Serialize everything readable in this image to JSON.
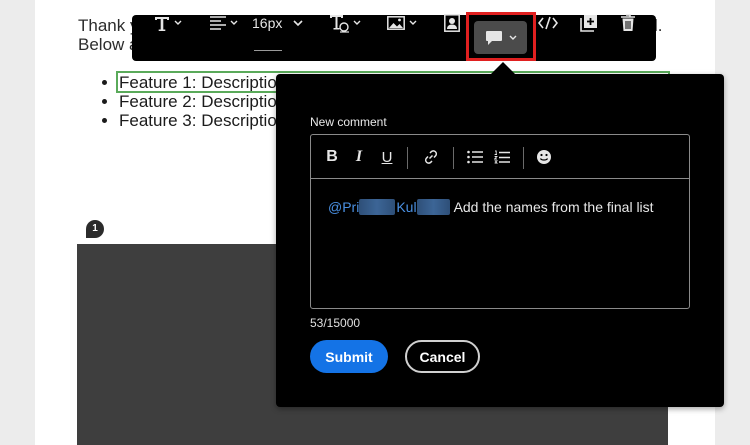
{
  "document": {
    "line1": "Thank y",
    "line2": "Below a",
    "line1_end": "l.",
    "features": [
      "Feature 1: Descriptio",
      "Feature 2: Descriptio",
      "Feature 3: Descriptio"
    ],
    "marker_number": "1"
  },
  "toolbar": {
    "font_size": "16px",
    "icons": [
      "text-style-icon",
      "align-icon",
      "font-size-dropdown",
      "text-color-icon",
      "image-icon",
      "portrait-icon",
      "comment-icon",
      "code-icon",
      "duplicate-icon",
      "trash-icon"
    ]
  },
  "comment": {
    "title": "New comment",
    "mention_prefix_1": "@Pri",
    "mention_prefix_2": "Kul",
    "text": "Add the names from the final list",
    "counter": "53/15000",
    "submit_label": "Submit",
    "cancel_label": "Cancel",
    "format": {
      "bold": "B",
      "italic": "I",
      "underline": "U"
    }
  },
  "colors": {
    "toolbar_bg": "#000000",
    "highlight": "#e02020",
    "accent": "#1473e6",
    "mention": "#4a90e2",
    "selection_outline": "#5aaa5a"
  }
}
